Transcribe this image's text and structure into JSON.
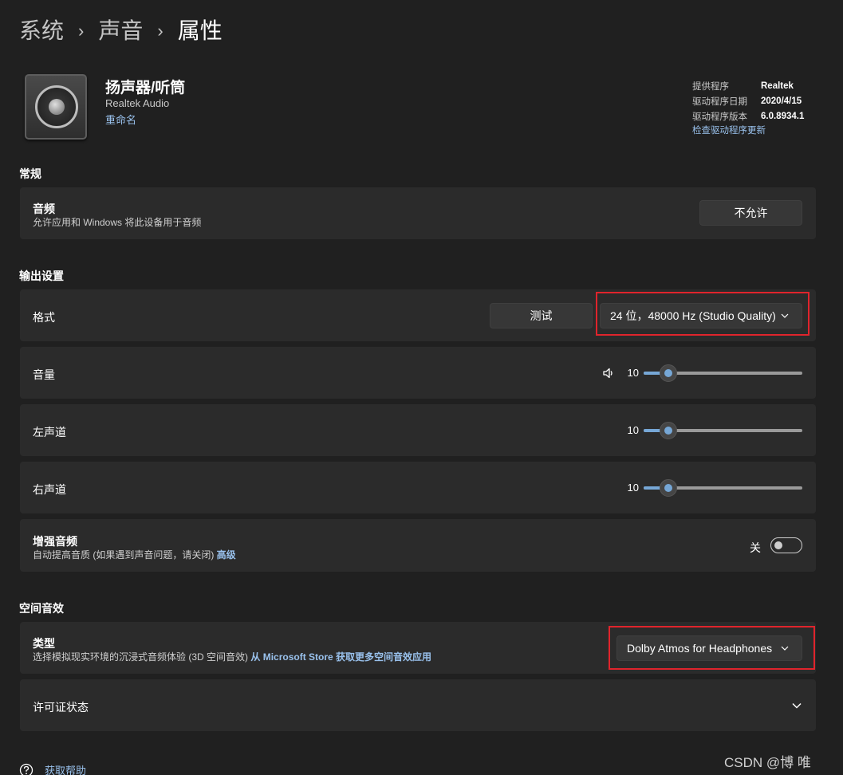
{
  "breadcrumb": [
    "系统",
    "声音",
    "属性"
  ],
  "device": {
    "name": "扬声器/听筒",
    "subtitle": "Realtek Audio",
    "rename_link": "重命名",
    "icon": "speaker-icon"
  },
  "driver": {
    "rows": [
      {
        "label": "提供程序",
        "value": "Realtek"
      },
      {
        "label": "驱动程序日期",
        "value": "2020/4/15"
      },
      {
        "label": "驱动程序版本",
        "value": "6.0.8934.1"
      }
    ],
    "update_link": "检查驱动程序更新"
  },
  "general": {
    "section_title": "常规",
    "audio": {
      "title": "音频",
      "description": "允许应用和 Windows 将此设备用于音频",
      "button": "不允许"
    }
  },
  "output": {
    "section_title": "输出设置",
    "format": {
      "label": "格式",
      "test_button": "测试",
      "selected": "24 位，48000 Hz (Studio Quality)"
    },
    "volume": {
      "label": "音量",
      "value": "10",
      "fraction": 0.1,
      "icon": "volume-icon"
    },
    "left": {
      "label": "左声道",
      "value": "10",
      "fraction": 0.1
    },
    "right": {
      "label": "右声道",
      "value": "10",
      "fraction": 0.1
    },
    "enhance": {
      "title": "增强音频",
      "description": "自动提高音质 (如果遇到声音问题，请关闭)",
      "advanced_link": "高级",
      "toggle_label": "关",
      "toggle_on": false
    }
  },
  "spatial": {
    "section_title": "空间音效",
    "type": {
      "title": "类型",
      "description": "选择模拟现实环境的沉浸式音频体验 (3D 空间音效)",
      "store_link": "从 Microsoft Store 获取更多空间音效应用",
      "selected": "Dolby Atmos for Headphones"
    },
    "license": {
      "title": "许可证状态"
    }
  },
  "help": {
    "label": "获取帮助",
    "icon": "help-icon"
  },
  "watermark": "CSDN @博  唯",
  "colors": {
    "accent": "#76a7d6",
    "link": "#99c1ec",
    "highlight_box": "#e0242c",
    "background": "#202020",
    "card": "#2b2b2b"
  }
}
